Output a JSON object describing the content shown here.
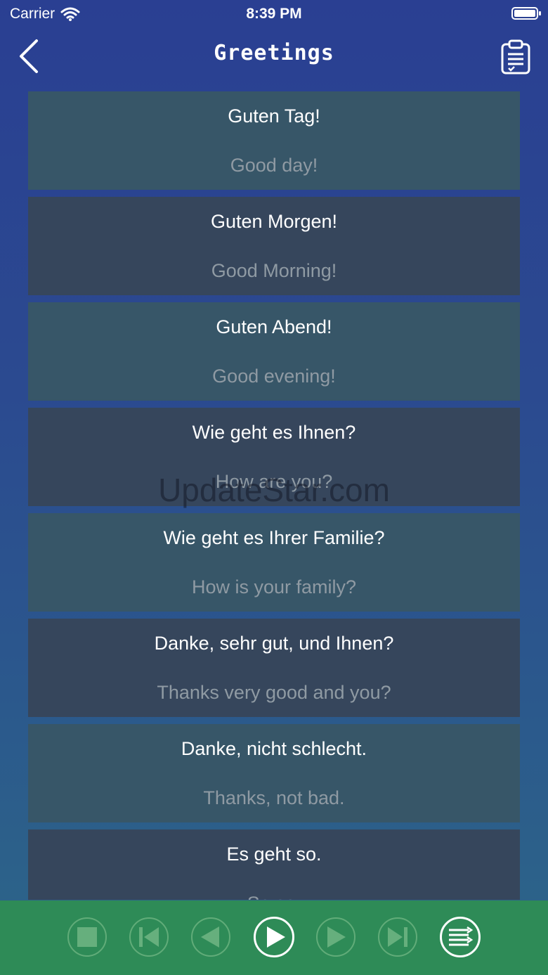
{
  "status_bar": {
    "carrier": "Carrier",
    "time": "8:39 PM"
  },
  "nav": {
    "title": "Greetings"
  },
  "phrases": [
    {
      "german": "Guten Tag!",
      "english": "Good day!"
    },
    {
      "german": "Guten Morgen!",
      "english": "Good Morning!"
    },
    {
      "german": "Guten Abend!",
      "english": "Good evening!"
    },
    {
      "german": "Wie geht es Ihnen?",
      "english": "How are you?"
    },
    {
      "german": "Wie geht es Ihrer Familie?",
      "english": "How is your family?"
    },
    {
      "german": "Danke, sehr gut, und Ihnen?",
      "english": "Thanks very good and you?"
    },
    {
      "german": "Danke, nicht schlecht.",
      "english": "Thanks, not bad."
    },
    {
      "german": "Es geht so.",
      "english": "So so."
    }
  ],
  "watermark": "UpdateStar.com",
  "player": {
    "controls": [
      "stop-icon",
      "skip-first-icon",
      "previous-icon",
      "play-icon",
      "next-icon",
      "skip-last-icon",
      "playlist-icon"
    ]
  },
  "colors": {
    "player_bar": "#2e8b57",
    "row_light": "#375668",
    "row_dark": "#36465c",
    "english_text": "#8f9aa3"
  }
}
